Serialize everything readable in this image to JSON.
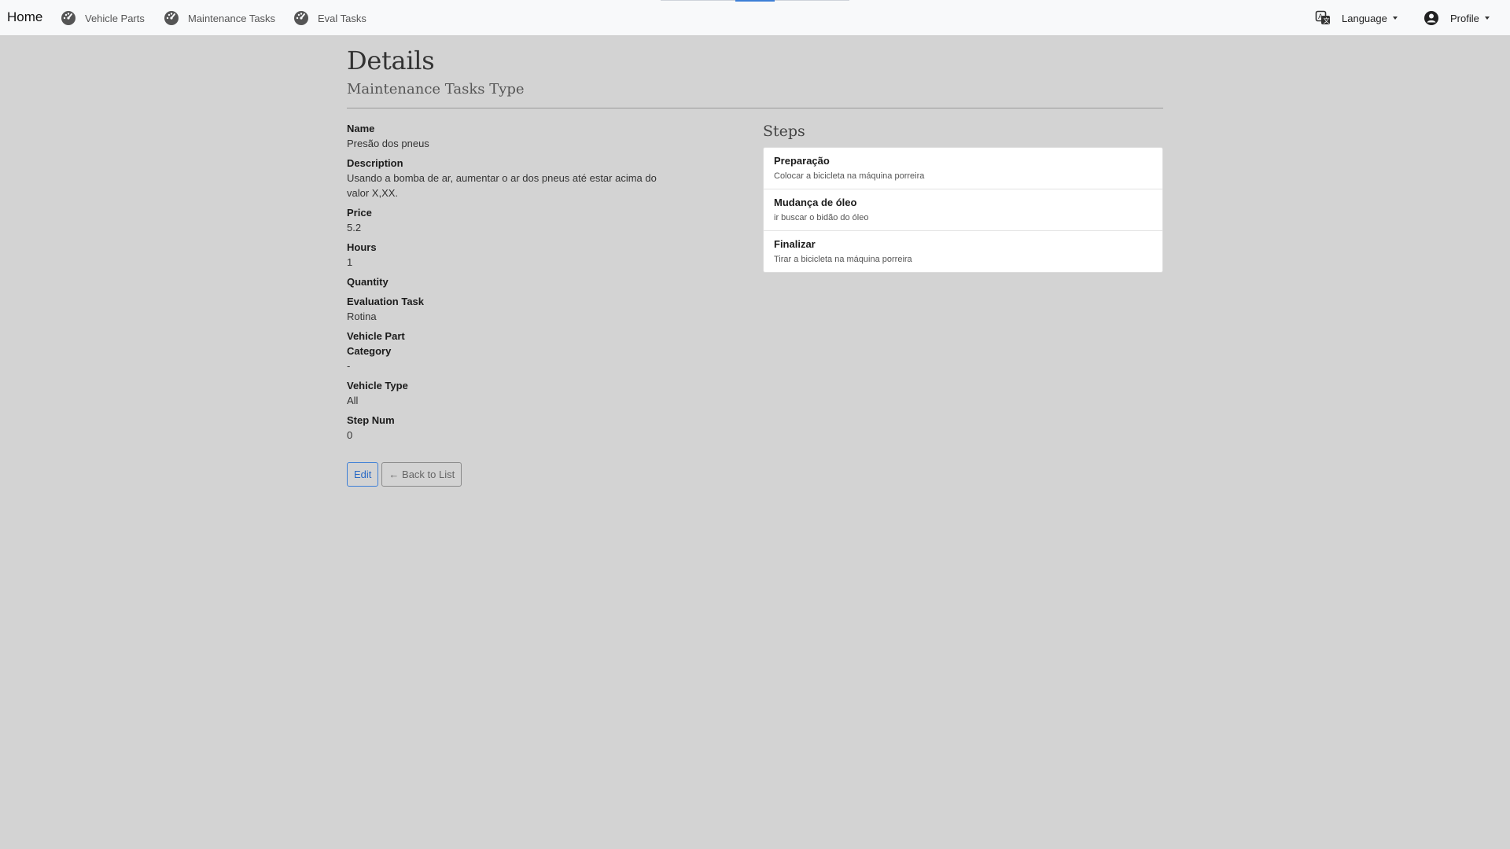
{
  "nav": {
    "brand": "Home",
    "links": [
      {
        "label": "Vehicle Parts",
        "icon": "gauge-icon"
      },
      {
        "label": "Maintenance Tasks",
        "icon": "gauge-icon"
      },
      {
        "label": "Eval Tasks",
        "icon": "gauge-icon"
      }
    ],
    "language_label": "Language",
    "profile_label": "Profile"
  },
  "page": {
    "title": "Details",
    "subtitle": "Maintenance Tasks Type"
  },
  "details": {
    "name_label": "Name",
    "name_value": "Presão dos pneus",
    "description_label": "Description",
    "description_value": "Usando a bomba de ar, aumentar o ar dos pneus até estar acima do valor X,XX.",
    "price_label": "Price",
    "price_value": "5.2",
    "hours_label": "Hours",
    "hours_value": "1",
    "quantity_label": "Quantity",
    "quantity_value": "",
    "evaluation_task_label": "Evaluation Task",
    "evaluation_task_value": "Rotina",
    "vehicle_part_label": "Vehicle Part",
    "vehicle_part_value": "",
    "category_label": "Category",
    "category_value": "-",
    "vehicle_type_label": "Vehicle Type",
    "vehicle_type_value": "All",
    "step_num_label": "Step Num",
    "step_num_value": "0"
  },
  "actions": {
    "edit_label": "Edit",
    "back_label": "← Back to List"
  },
  "steps": {
    "title": "Steps",
    "items": [
      {
        "title": "Preparação",
        "subtitle": "Colocar a bicicleta na máquina porreira"
      },
      {
        "title": "Mudança de óleo",
        "subtitle": "ir buscar o bidão do óleo"
      },
      {
        "title": "Finalizar",
        "subtitle": "Tirar a bicicleta na máquina porreira"
      }
    ]
  },
  "colors": {
    "background": "#d3d3d3",
    "navbar": "#f8f9fa",
    "accent": "#3d7fd6"
  }
}
